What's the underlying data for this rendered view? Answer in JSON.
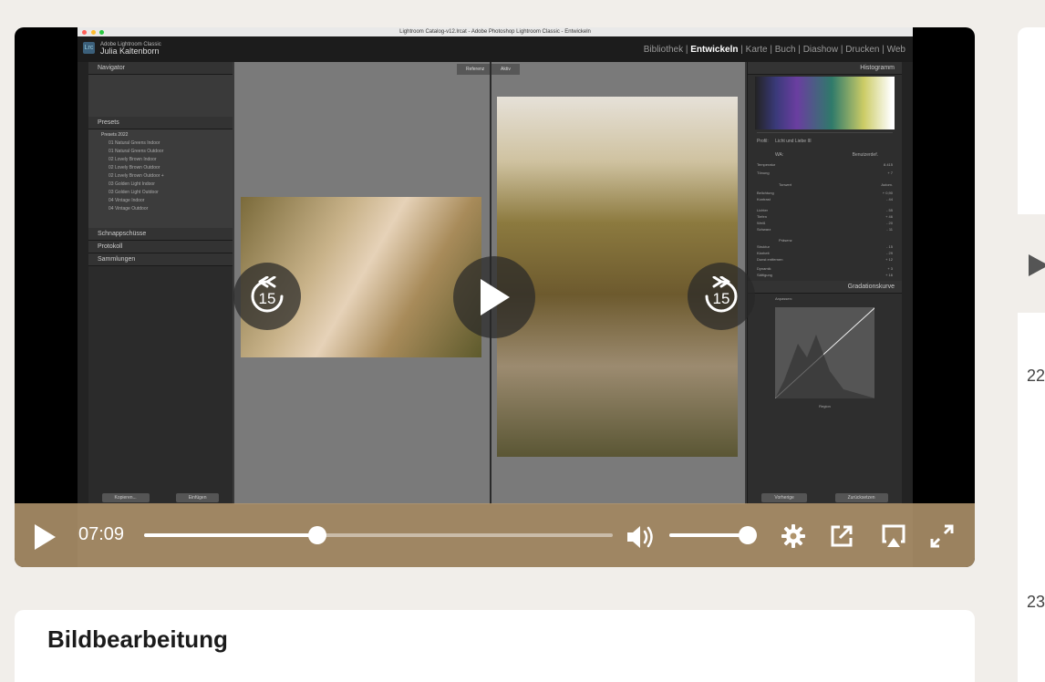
{
  "screen": {
    "lightroom": {
      "window_title": "Lightroom Catalog-v12.lrcat - Adobe Photoshop Lightroom Classic - Entwickeln",
      "app_name": "Adobe Lightroom Classic",
      "user_name": "Julia Kaltenborn",
      "modules": [
        "Bibliothek",
        "Entwickeln",
        "Karte",
        "Buch",
        "Diashow",
        "Drucken",
        "Web"
      ],
      "active_module": "Entwickeln",
      "left_panels": {
        "navigator": "Navigator",
        "presets": "Presets",
        "preset_group": "Presets 2022",
        "preset_items": [
          "01 Natural Greens Indoor",
          "01 Natural Greens Outdoor",
          "02 Lovely Brown Indoor",
          "02 Lovely Brown Outdoor",
          "02 Lovely Brown Outdoor +",
          "03 Golden Light Indoor",
          "03 Golden Light Outdoor",
          "04 Vintage Indoor",
          "04 Vintage Outdoor"
        ],
        "snapshots": "Schnappschüsse",
        "history": "Protokoll",
        "collections": "Sammlungen",
        "copy_btn": "Kopieren...",
        "paste_btn": "Einfügen"
      },
      "compare_labels": {
        "reference": "Referenz",
        "active": "Aktiv"
      },
      "right_panels": {
        "histogram": "Histogramm",
        "profile_label": "Profil:",
        "profile_value": "Licht und Liebe III",
        "wb_label": "WA:",
        "wb_value": "Benutzerdef.",
        "temperature_label": "Temperatur",
        "temperature_value": "8.415",
        "tint_label": "Tönung",
        "tint_value": "+ 7",
        "tone_label": "Tonwert",
        "tone_auto": "Autom.",
        "exposure_label": "Belichtung",
        "exposure_value": "+ 0,90",
        "contrast_label": "Kontrast",
        "contrast_value": "- 44",
        "highlights_label": "Lichter",
        "highlights_value": "- 55",
        "shadows_label": "Tiefen",
        "shadows_value": "+ 46",
        "whites_label": "Weiß",
        "whites_value": "- 20",
        "blacks_label": "Schwarz",
        "blacks_value": "- 11",
        "presence_label": "Präsenz",
        "texture_label": "Struktur",
        "texture_value": "- 15",
        "clarity_label": "Klarheit",
        "clarity_value": "- 29",
        "dehaze_label": "Dunst entfernen",
        "dehaze_value": "+ 12",
        "vibrance_label": "Dynamik",
        "vibrance_value": "+ 3",
        "saturation_label": "Sättigung",
        "saturation_value": "+ 16",
        "tone_curve": "Gradationskurve",
        "adjust_label": "Anpassen:",
        "region_label": "Region",
        "prev_btn": "Vorherige",
        "reset_btn": "Zurücksetzen"
      }
    },
    "colors": {
      "controls_bg": "#b0946c",
      "page_bg": "#f1eeea"
    }
  },
  "player": {
    "current_time": "07:09",
    "progress_fraction": 0.37,
    "volume_fraction": 0.96,
    "rewind_seconds": "15",
    "forward_seconds": "15"
  },
  "lesson": {
    "title": "Bildbearbeitung"
  },
  "sidebar": {
    "numbers": [
      "22",
      "23"
    ]
  }
}
